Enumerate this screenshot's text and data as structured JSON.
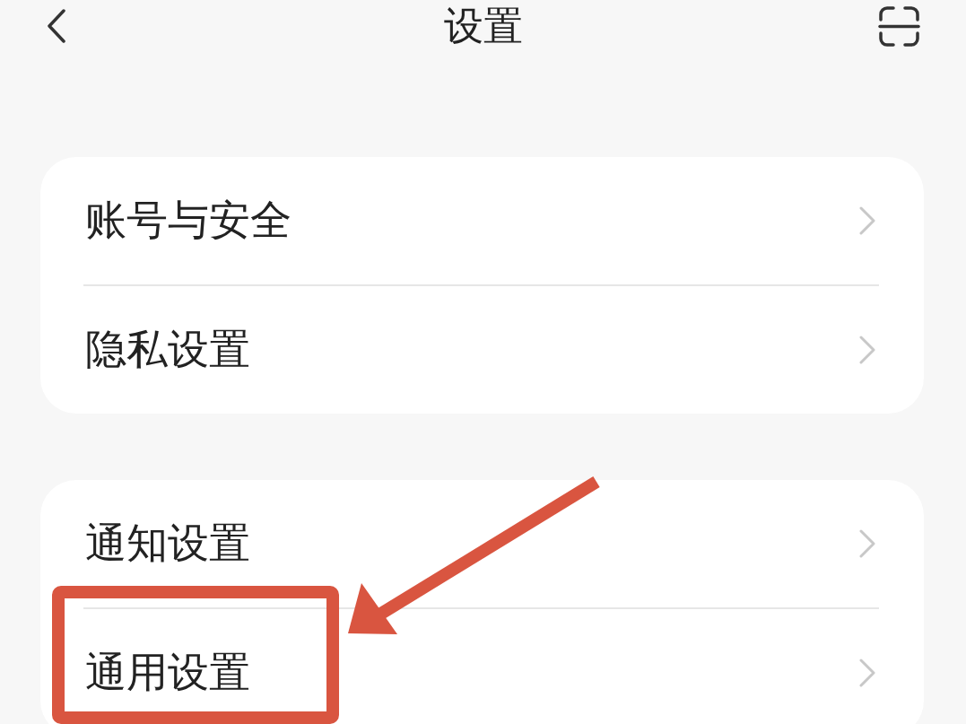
{
  "header": {
    "title": "设置"
  },
  "sections": [
    {
      "items": [
        {
          "label": "账号与安全",
          "highlighted": false
        },
        {
          "label": "隐私设置",
          "highlighted": false
        }
      ]
    },
    {
      "items": [
        {
          "label": "通知设置",
          "highlighted": false
        },
        {
          "label": "通用设置",
          "highlighted": true
        }
      ]
    }
  ]
}
